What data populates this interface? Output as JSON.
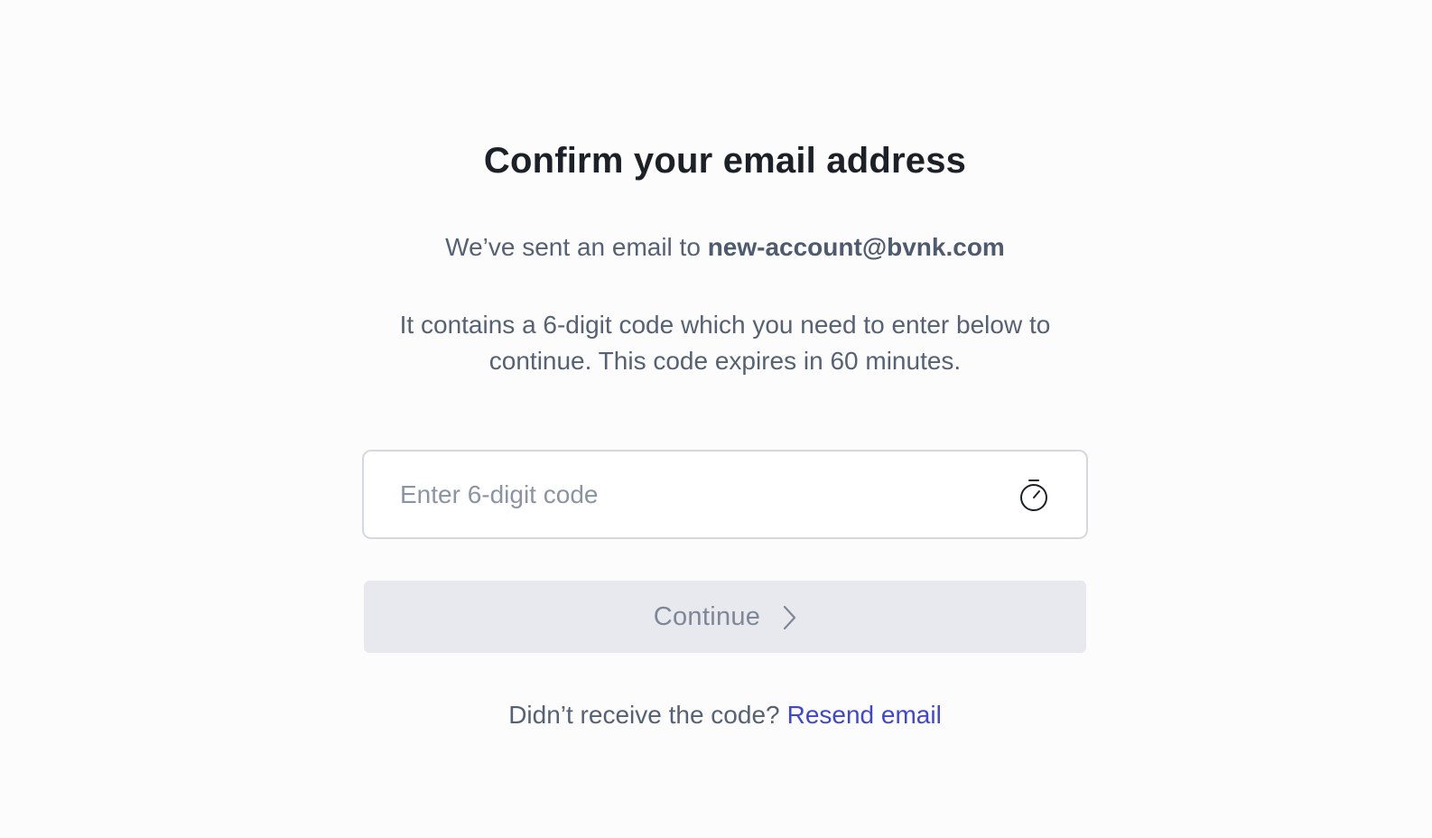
{
  "heading": "Confirm your email address",
  "sent": {
    "prefix": "We’ve sent an email to",
    "email": "new-account@bvnk.com"
  },
  "info": "It contains a 6-digit code which you need to enter below to continue. This code expires in 60 minutes.",
  "code_input": {
    "placeholder": "Enter 6-digit code",
    "value": "",
    "icon": "stopwatch-icon"
  },
  "continue_button": {
    "label": "Continue",
    "icon": "chevron-right-icon",
    "disabled": true
  },
  "resend": {
    "prompt": "Didn’t receive the code?",
    "link_label": "Resend email"
  },
  "colors": {
    "background": "#fcfcfc",
    "heading": "#1c2027",
    "body_text": "#556174",
    "link": "#3f46d6",
    "button_disabled_bg": "#e8e9ee",
    "button_disabled_text": "#7f8796",
    "input_border": "#d5d8de"
  }
}
